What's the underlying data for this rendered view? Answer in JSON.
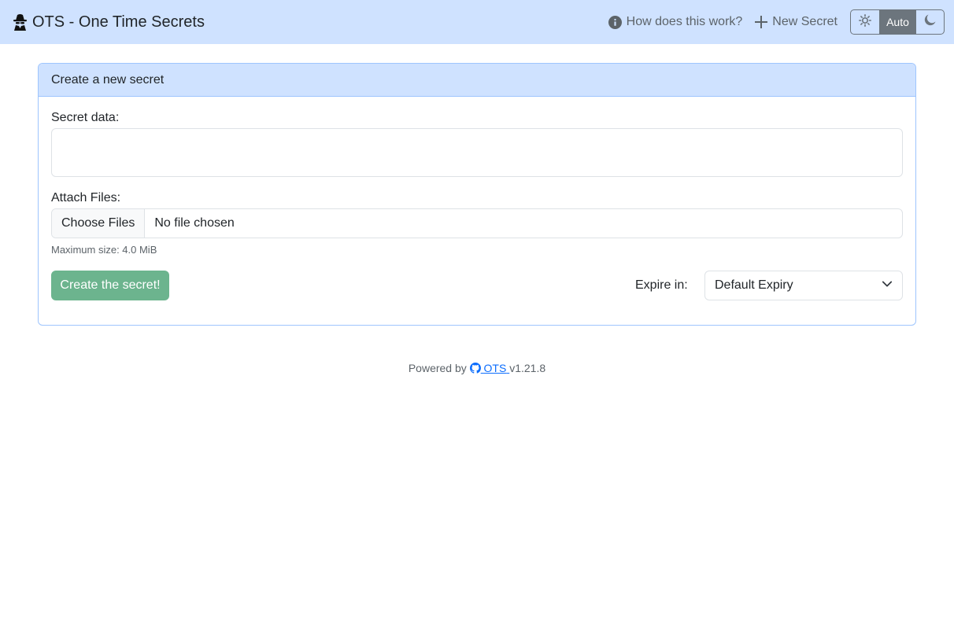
{
  "navbar": {
    "brand_title": "OTS - One Time Secrets",
    "brand_icon": "spy-icon",
    "how_link": "How does this work?",
    "new_secret_link": "New Secret",
    "theme": {
      "light_icon": "sun-icon",
      "auto_label": "Auto",
      "dark_icon": "moon-icon",
      "selected": "Auto"
    }
  },
  "card": {
    "header": "Create a new secret",
    "secret_label": "Secret data:",
    "secret_value": "",
    "files_label": "Attach Files:",
    "choose_files_label": "Choose Files",
    "no_file_text": "No file chosen",
    "max_size_text": "Maximum size: 4.0 MiB",
    "submit_label": "Create the secret!",
    "expire_label": "Expire in:",
    "expire_value": "Default Expiry"
  },
  "footer": {
    "powered_by": "Powered by",
    "link_text": "OTS",
    "version": "v1.21.8"
  },
  "colors": {
    "navbar_bg": "#cfe2ff",
    "card_border": "#9ec5fe",
    "submit_bg": "#6cb48e",
    "link": "#0d6efd"
  }
}
